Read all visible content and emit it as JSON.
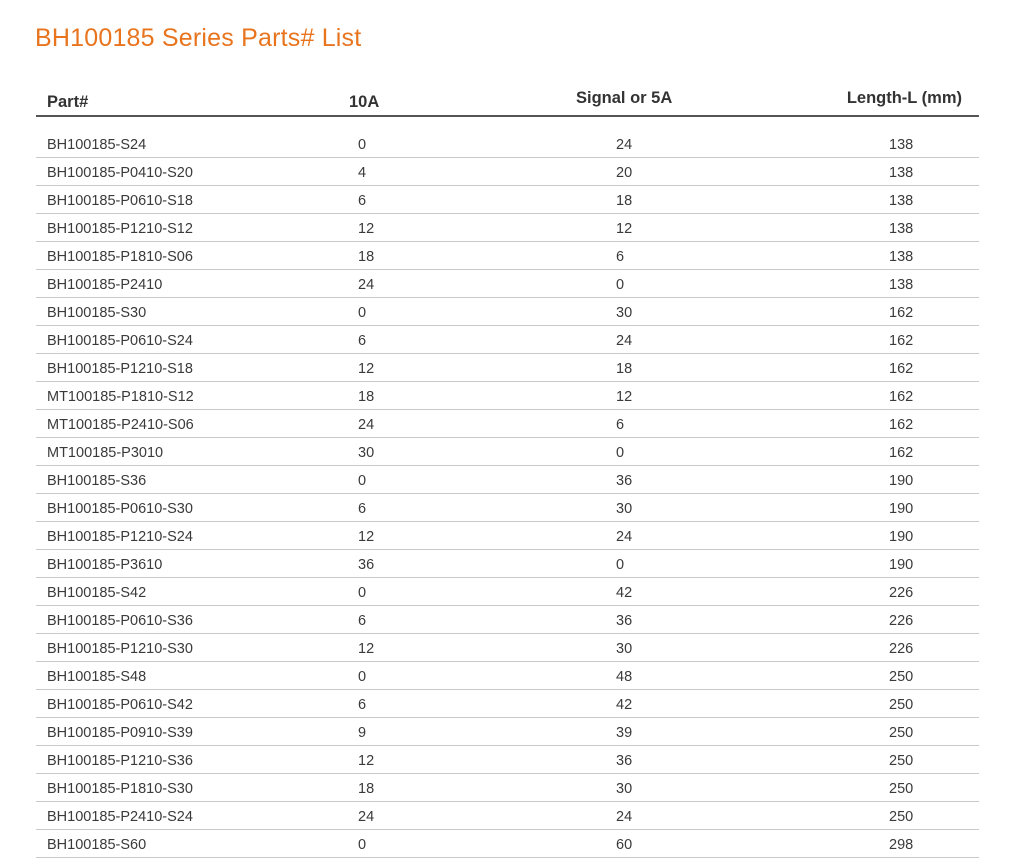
{
  "title": "BH100185 Series Parts# List",
  "table": {
    "headers": [
      "Part#",
      "10A",
      "Signal or 5A",
      "Length-L (mm)"
    ],
    "rows": [
      [
        "BH100185-S24",
        "0",
        "24",
        "138"
      ],
      [
        "BH100185-P0410-S20",
        "4",
        "20",
        "138"
      ],
      [
        "BH100185-P0610-S18",
        "6",
        "18",
        "138"
      ],
      [
        "BH100185-P1210-S12",
        "12",
        "12",
        "138"
      ],
      [
        "BH100185-P1810-S06",
        "18",
        "6",
        "138"
      ],
      [
        "BH100185-P2410",
        "24",
        "0",
        "138"
      ],
      [
        "BH100185-S30",
        "0",
        "30",
        "162"
      ],
      [
        "BH100185-P0610-S24",
        "6",
        "24",
        "162"
      ],
      [
        "BH100185-P1210-S18",
        "12",
        "18",
        "162"
      ],
      [
        "MT100185-P1810-S12",
        "18",
        "12",
        "162"
      ],
      [
        "MT100185-P2410-S06",
        "24",
        "6",
        "162"
      ],
      [
        "MT100185-P3010",
        "30",
        "0",
        "162"
      ],
      [
        "BH100185-S36",
        "0",
        "36",
        "190"
      ],
      [
        "BH100185-P0610-S30",
        "6",
        "30",
        "190"
      ],
      [
        "BH100185-P1210-S24",
        "12",
        "24",
        "190"
      ],
      [
        "BH100185-P3610",
        "36",
        "0",
        "190"
      ],
      [
        "BH100185-S42",
        "0",
        "42",
        "226"
      ],
      [
        "BH100185-P0610-S36",
        "6",
        "36",
        "226"
      ],
      [
        "BH100185-P1210-S30",
        "12",
        "30",
        "226"
      ],
      [
        "BH100185-S48",
        "0",
        "48",
        "250"
      ],
      [
        "BH100185-P0610-S42",
        "6",
        "42",
        "250"
      ],
      [
        "BH100185-P0910-S39",
        "9",
        "39",
        "250"
      ],
      [
        "BH100185-P1210-S36",
        "12",
        "36",
        "250"
      ],
      [
        "BH100185-P1810-S30",
        "18",
        "30",
        "250"
      ],
      [
        "BH100185-P2410-S24",
        "24",
        "24",
        "250"
      ],
      [
        "BH100185-S60",
        "0",
        "60",
        "298"
      ]
    ]
  }
}
